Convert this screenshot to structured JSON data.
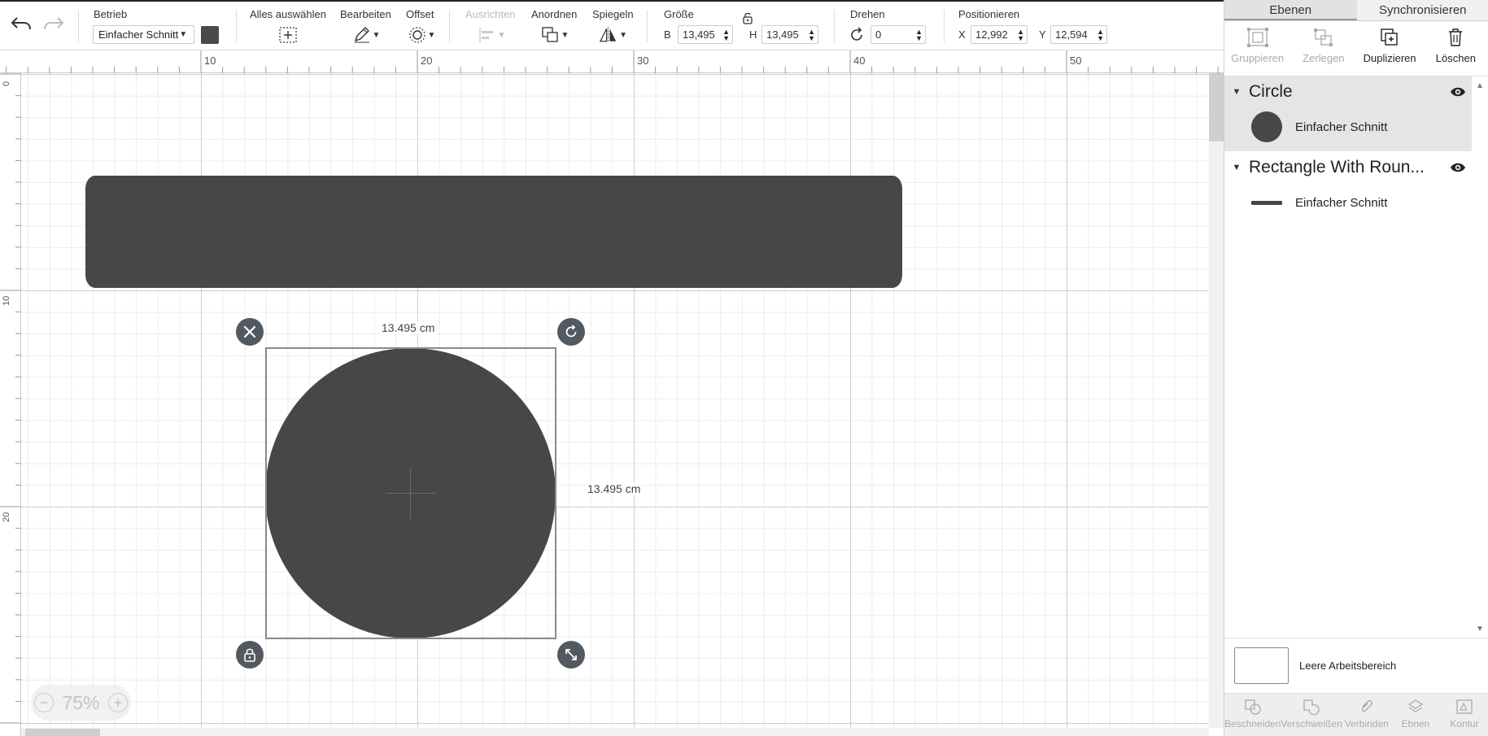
{
  "toolbar": {
    "operation": {
      "label": "Betrieb",
      "value": "Einfacher Schnitt"
    },
    "select_all": {
      "label": "Alles auswählen"
    },
    "edit": {
      "label": "Bearbeiten"
    },
    "offset": {
      "label": "Offset"
    },
    "align": {
      "label": "Ausrichten"
    },
    "arrange": {
      "label": "Anordnen"
    },
    "flip": {
      "label": "Spiegeln"
    },
    "size": {
      "label": "Größe",
      "w_label": "B",
      "w_value": "13,495",
      "h_label": "H",
      "h_value": "13,495"
    },
    "rotate": {
      "label": "Drehen",
      "value": "0"
    },
    "position": {
      "label": "Positionieren",
      "x_label": "X",
      "x_value": "12,992",
      "y_label": "Y",
      "y_value": "12,594"
    }
  },
  "ruler": {
    "top": [
      "10",
      "20",
      "30",
      "40",
      "50"
    ],
    "left": [
      "0",
      "10",
      "20"
    ]
  },
  "canvas": {
    "width_dim": "13.495 cm",
    "height_dim": "13.495 cm",
    "zoom": {
      "value": "75%",
      "minus": "−",
      "plus": "+"
    }
  },
  "panel": {
    "tabs": [
      "Ebenen",
      "Synchronisieren"
    ],
    "actions": [
      {
        "label": "Gruppieren",
        "icon": "group-icon",
        "enabled": false
      },
      {
        "label": "Zerlegen",
        "icon": "ungroup-icon",
        "enabled": false
      },
      {
        "label": "Duplizieren",
        "icon": "duplicate-icon",
        "enabled": true
      },
      {
        "label": "Löschen",
        "icon": "trash-icon",
        "enabled": true
      }
    ],
    "layers": [
      {
        "title": "Circle",
        "item": "Einfacher Schnitt"
      },
      {
        "title": "Rectangle With Roun...",
        "item": "Einfacher Schnitt"
      }
    ],
    "blank": "Leere Arbeitsbereich",
    "bottom_actions": [
      "Beschneiden",
      "Verschweißen",
      "Verbinden",
      "Ebnen",
      "Kontur"
    ]
  },
  "colors": {
    "shape": "#474747",
    "handle": "#525960",
    "accent_dark": "#222222"
  }
}
